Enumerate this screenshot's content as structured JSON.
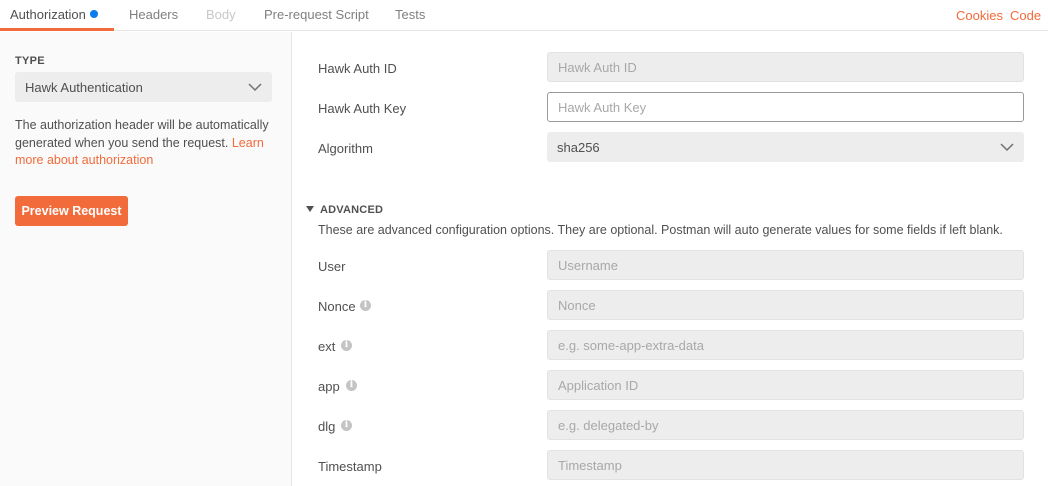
{
  "tabs": {
    "authorization": "Authorization",
    "headers": "Headers",
    "body": "Body",
    "prerequest": "Pre-request Script",
    "tests": "Tests"
  },
  "links": {
    "cookies": "Cookies",
    "code": "Code"
  },
  "left": {
    "type_label": "TYPE",
    "type_value": "Hawk Authentication",
    "description": "The authorization header will be automatically generated when you send the request.",
    "learn_more": "Learn more about authorization",
    "preview_button": "Preview Request"
  },
  "form": {
    "hawk_auth_id": {
      "label": "Hawk Auth ID",
      "placeholder": "Hawk Auth ID"
    },
    "hawk_auth_key": {
      "label": "Hawk Auth Key",
      "placeholder": "Hawk Auth Key"
    },
    "algorithm": {
      "label": "Algorithm",
      "value": "sha256"
    }
  },
  "advanced": {
    "title": "ADVANCED",
    "description": "These are advanced configuration options. They are optional. Postman will auto generate values for some fields if left blank.",
    "user": {
      "label": "User",
      "placeholder": "Username"
    },
    "nonce": {
      "label": "Nonce",
      "placeholder": "Nonce"
    },
    "ext": {
      "label": "ext",
      "placeholder": "e.g. some-app-extra-data"
    },
    "app": {
      "label": "app",
      "placeholder": "Application ID"
    },
    "dlg": {
      "label": "dlg",
      "placeholder": "e.g. delegated-by"
    },
    "timestamp": {
      "label": "Timestamp",
      "placeholder": "Timestamp"
    }
  },
  "colors": {
    "accent": "#f26b3a",
    "indicator": "#097bed",
    "field_bg": "#ededed",
    "panel_bg": "#fafafa"
  },
  "icons": {
    "select_chevron": "chevron-down-icon",
    "advanced_toggle": "caret-down-icon",
    "info": "info-icon"
  }
}
